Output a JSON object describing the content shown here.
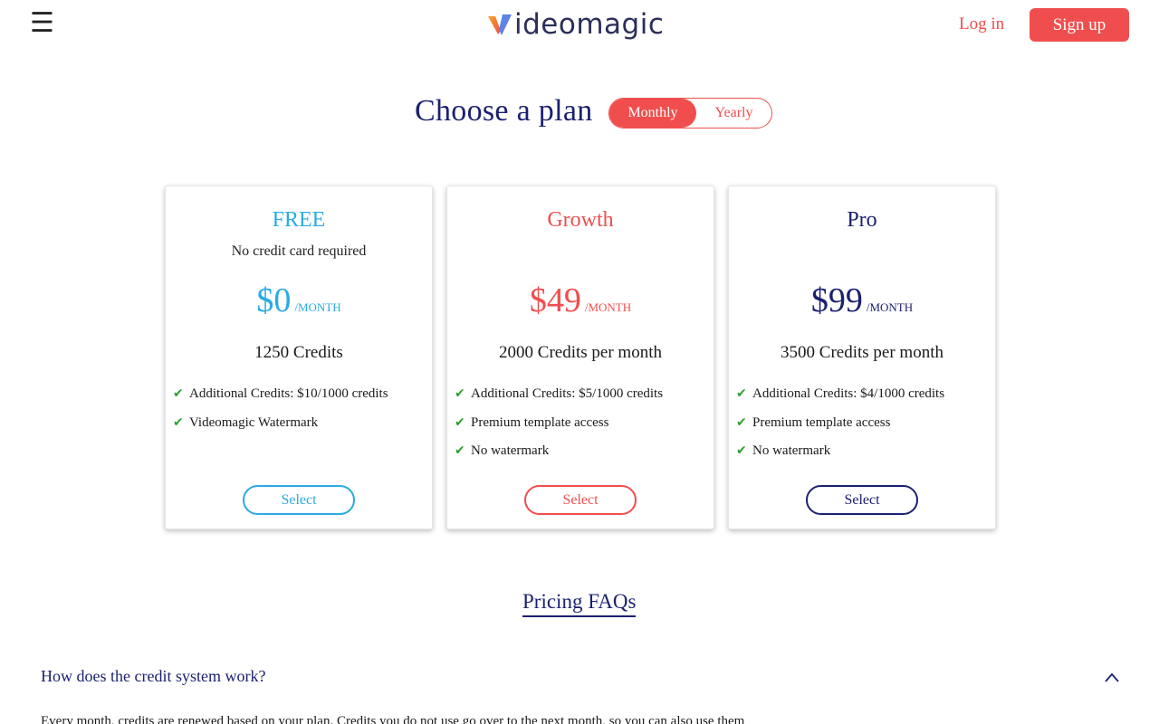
{
  "header": {
    "logo_text": "ideomagic",
    "login_label": "Log in",
    "signup_label": "Sign up"
  },
  "plans_section": {
    "title": "Choose a plan",
    "billing_toggle": {
      "options": [
        "Monthly",
        "Yearly"
      ],
      "selected": "Monthly"
    }
  },
  "plans": [
    {
      "name": "FREE",
      "subtitle": "No credit card required",
      "price": "$0",
      "period": "/MONTH",
      "credits": "1250 Credits",
      "features": [
        "Additional Credits: $10/1000 credits",
        "Videomagic Watermark"
      ],
      "button_label": "Select",
      "accent_color": "#29abe2"
    },
    {
      "name": "Growth",
      "subtitle": "",
      "price": "$49",
      "period": "/MONTH",
      "credits": "2000 Credits per month",
      "features": [
        "Additional Credits: $5/1000 credits",
        "Premium template access",
        "No watermark"
      ],
      "button_label": "Select",
      "accent_color": "#f04e4e"
    },
    {
      "name": "Pro",
      "subtitle": "",
      "price": "$99",
      "period": "/MONTH",
      "credits": "3500 Credits per month",
      "features": [
        "Additional Credits: $4/1000 credits",
        "Premium template access",
        "No watermark"
      ],
      "button_label": "Select",
      "accent_color": "#1b2170"
    }
  ],
  "faq": {
    "title": "Pricing FAQs",
    "items": [
      {
        "question": "How does the credit system work?",
        "answer": "Every month, credits are renewed based on your plan. Credits you do not use go over to the next month, so you can also use them",
        "expanded": true
      }
    ]
  },
  "colors": {
    "brand_red": "#f04e4e",
    "navy": "#1b2170",
    "free_blue": "#29abe2",
    "check_green": "#2ca02c"
  },
  "icons": {
    "menu": "hamburger-icon",
    "check": "check-icon",
    "faq_toggle": "chevron-up-icon"
  }
}
